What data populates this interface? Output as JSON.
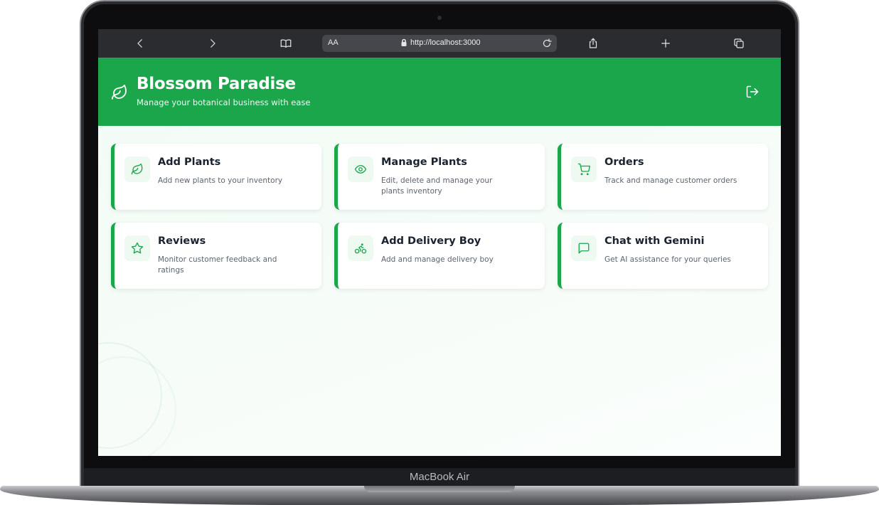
{
  "device": {
    "label": "MacBook Air"
  },
  "browser": {
    "text_size_label": "AA",
    "url": "http://localhost:3000"
  },
  "header": {
    "title": "Blossom Paradise",
    "subtitle": "Manage your botanical business with ease"
  },
  "cards": [
    {
      "title": "Add Plants",
      "description": "Add new plants to your inventory",
      "icon": "leaf-icon"
    },
    {
      "title": "Manage Plants",
      "description": "Edit, delete and manage your plants inventory",
      "icon": "eye-icon"
    },
    {
      "title": "Orders",
      "description": "Track and manage customer orders",
      "icon": "cart-icon"
    },
    {
      "title": "Reviews",
      "description": "Monitor customer feedback and ratings",
      "icon": "star-icon"
    },
    {
      "title": "Add Delivery Boy",
      "description": "Add and manage delivery boy",
      "icon": "bike-icon"
    },
    {
      "title": "Chat with Gemini",
      "description": "Get AI assistance for your queries",
      "icon": "message-icon"
    }
  ],
  "colors": {
    "brand": "#1ba64c",
    "toolbar": "#2a2c30"
  }
}
